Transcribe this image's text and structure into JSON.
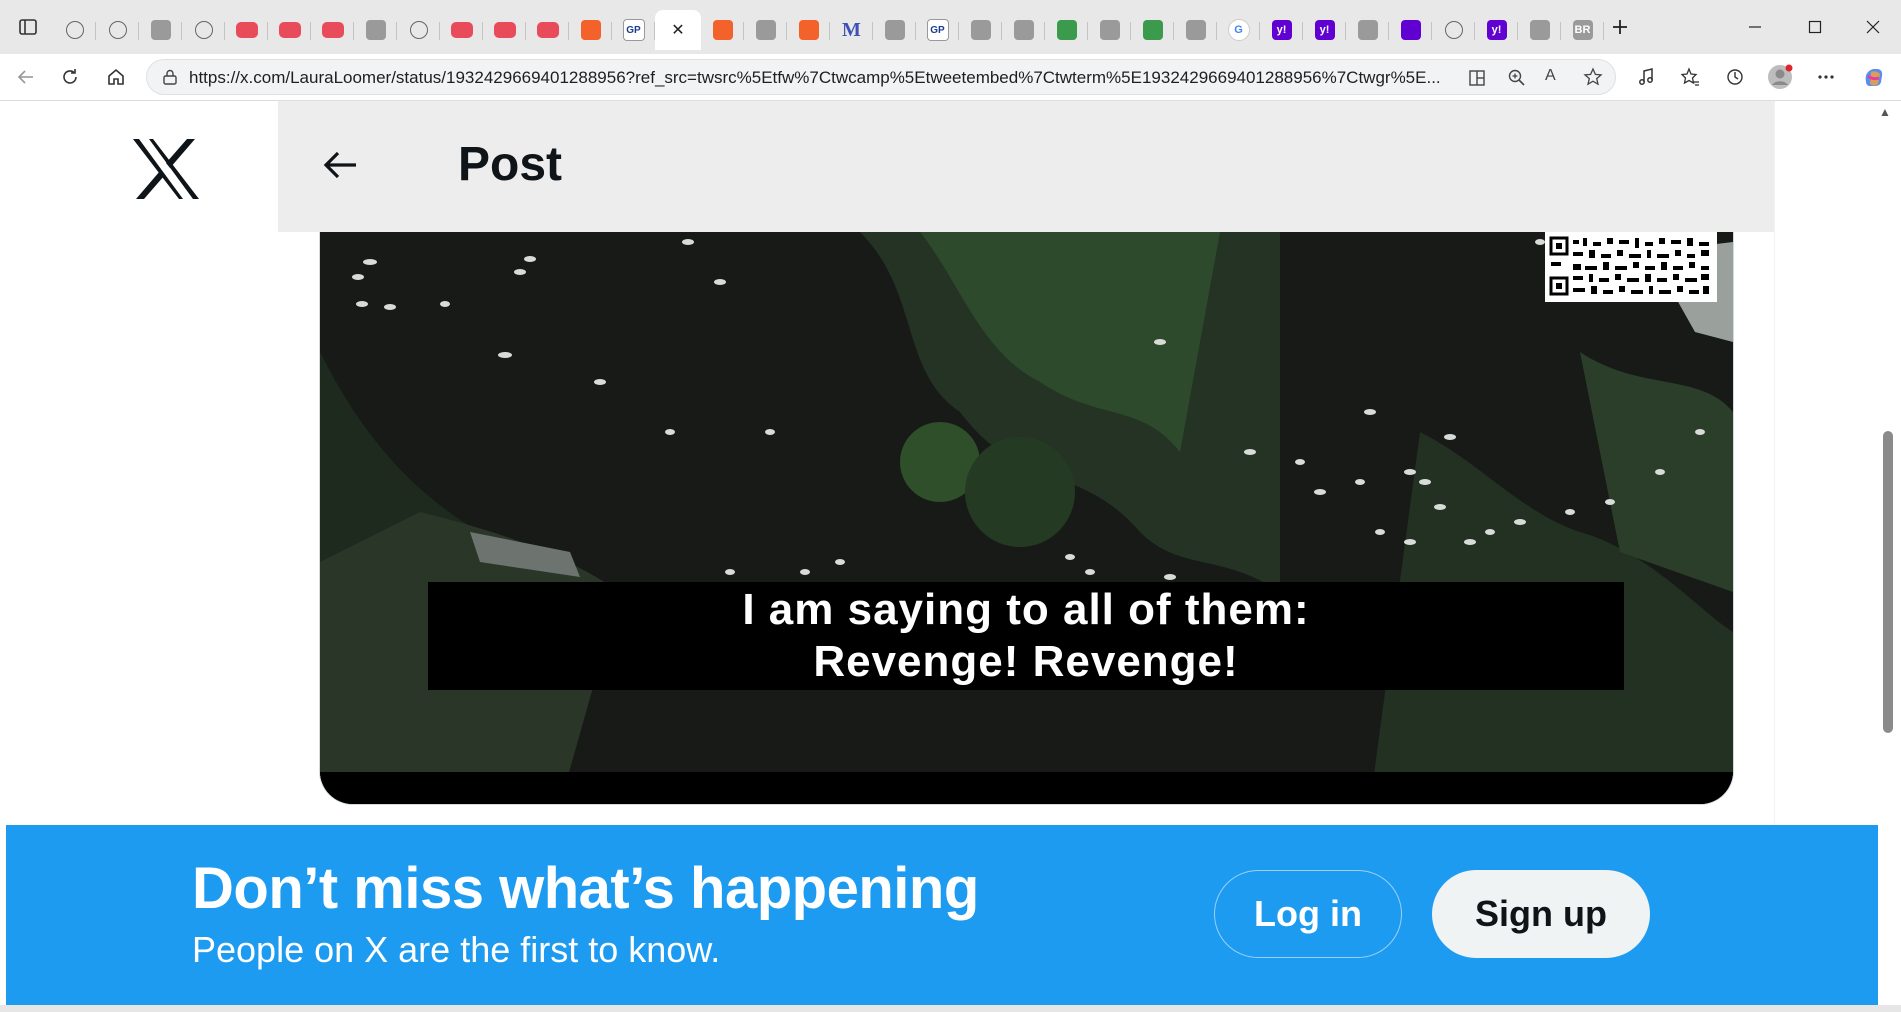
{
  "browser": {
    "tabs": [
      {
        "icon": "globe-icon",
        "kind": "globe"
      },
      {
        "icon": "globe-icon",
        "kind": "globe"
      },
      {
        "icon": "news-icon",
        "kind": "grey",
        "text": ""
      },
      {
        "icon": "globe-icon",
        "kind": "globe"
      },
      {
        "icon": "youtube-icon",
        "kind": "yt"
      },
      {
        "icon": "youtube-icon",
        "kind": "yt"
      },
      {
        "icon": "youtube-icon",
        "kind": "yt"
      },
      {
        "icon": "shield-icon",
        "kind": "grey"
      },
      {
        "icon": "globe-icon",
        "kind": "globe"
      },
      {
        "icon": "youtube-icon",
        "kind": "yt"
      },
      {
        "icon": "youtube-icon",
        "kind": "yt"
      },
      {
        "icon": "youtube-icon",
        "kind": "yt"
      },
      {
        "icon": "bookmark-icon",
        "kind": "orange"
      },
      {
        "icon": "gp-icon",
        "kind": "gp",
        "text": "GP"
      },
      {
        "icon": "x-icon",
        "kind": "active",
        "text": "✕"
      },
      {
        "icon": "bookmark-icon",
        "kind": "orange"
      },
      {
        "icon": "document-icon",
        "kind": "grey"
      },
      {
        "icon": "bookmark-icon",
        "kind": "orange"
      },
      {
        "icon": "m-icon",
        "kind": "m",
        "text": "M"
      },
      {
        "icon": "image-icon",
        "kind": "grey"
      },
      {
        "icon": "gp-icon",
        "kind": "gp",
        "text": "GP"
      },
      {
        "icon": "seal-icon",
        "kind": "grey"
      },
      {
        "icon": "seal-icon",
        "kind": "grey"
      },
      {
        "icon": "link-icon",
        "kind": "green"
      },
      {
        "icon": "feather-icon",
        "kind": "grey"
      },
      {
        "icon": "book-icon",
        "kind": "green"
      },
      {
        "icon": "shield-icon",
        "kind": "grey"
      },
      {
        "icon": "google-icon",
        "kind": "g",
        "text": "G"
      },
      {
        "icon": "yahoo-icon",
        "kind": "yahoo",
        "text": "y!"
      },
      {
        "icon": "yahoo-icon",
        "kind": "yahoo",
        "text": "y!"
      },
      {
        "icon": "planet-icon",
        "kind": "grey"
      },
      {
        "icon": "mail-icon",
        "kind": "mail"
      },
      {
        "icon": "globe-icon",
        "kind": "globe"
      },
      {
        "icon": "yahoo-icon",
        "kind": "yahoo",
        "text": "y!"
      },
      {
        "icon": "game-icon",
        "kind": "grey"
      },
      {
        "icon": "br-icon",
        "kind": "grey",
        "text": "BR"
      }
    ],
    "url": "https://x.com/LauraLoomer/status/1932429669401288956?ref_src=twsrc%5Etfw%7Ctwcamp%5Etweetembed%7Ctwterm%5E1932429669401288956%7Ctwgr%5E..."
  },
  "page": {
    "header_title": "Post",
    "video_subtitle_line1": "I am saying to all of them:",
    "video_subtitle_line2": "Revenge! Revenge!"
  },
  "banner": {
    "title": "Don’t miss what’s happening",
    "subtitle": "People on X are the first to know.",
    "login_label": "Log in",
    "signup_label": "Sign up"
  },
  "colors": {
    "banner_blue": "#1d9bf0",
    "text_dark": "#0f1419"
  }
}
